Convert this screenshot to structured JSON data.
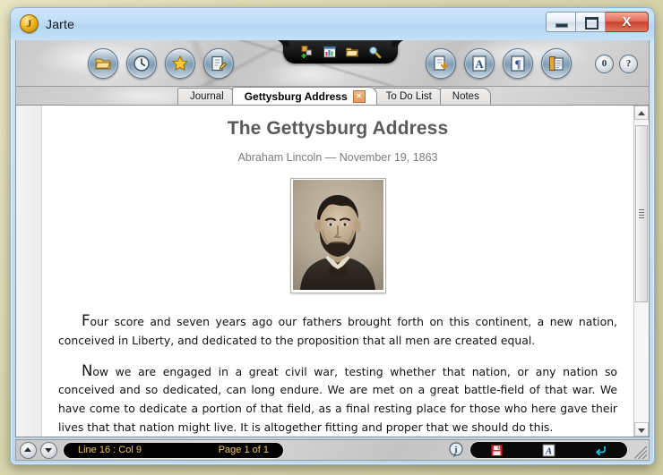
{
  "window": {
    "app_title": "Jarte",
    "logo_letter": "J",
    "controls": {
      "minimize": "–",
      "maximize": "□",
      "close": "X"
    }
  },
  "toolbar": {
    "left_buttons": [
      {
        "name": "open-folder-icon",
        "tip": "Open"
      },
      {
        "name": "clock-icon",
        "tip": "Recent Files"
      },
      {
        "name": "star-icon",
        "tip": "Favorites"
      },
      {
        "name": "edit-note-icon",
        "tip": "Edit"
      }
    ],
    "dock_buttons": [
      {
        "name": "new-document-icon",
        "tip": "New"
      },
      {
        "name": "table-chart-icon",
        "tip": "Insert Table"
      },
      {
        "name": "folder-icon",
        "tip": "Browse"
      },
      {
        "name": "search-icon",
        "tip": "Find"
      }
    ],
    "right_buttons": [
      {
        "name": "save-document-icon",
        "tip": "Save"
      },
      {
        "name": "font-letter-icon",
        "tip": "Font"
      },
      {
        "name": "paragraph-icon",
        "tip": "Paragraph"
      },
      {
        "name": "clipboard-icon",
        "tip": "Clipboard"
      }
    ],
    "extras": [
      {
        "name": "zero-button",
        "label": "0"
      },
      {
        "name": "help-button",
        "label": "?"
      }
    ]
  },
  "tabs": [
    {
      "label": "Journal",
      "active": false,
      "closable": false
    },
    {
      "label": "Gettysburg Address",
      "active": true,
      "closable": true,
      "close_label": "×"
    },
    {
      "label": "To Do List",
      "active": false,
      "closable": false
    },
    {
      "label": "Notes",
      "active": false,
      "closable": false
    }
  ],
  "document": {
    "title": "The Gettysburg Address",
    "byline": "Abraham Lincoln — November 19, 1863",
    "image_alt": "Portrait photograph of Abraham Lincoln",
    "paragraphs": [
      {
        "cap": "F",
        "rest": "our score and seven years ago our fathers brought forth on this continent, a new nation, conceived in Liberty, and dedicated to the proposition that all men are created equal."
      },
      {
        "cap": "N",
        "rest": "ow we are engaged in a great civil war, testing whether that nation, or any nation so conceived and so dedicated, can long endure. We are met on a great battle-field of that war. We have come to dedicate a portion of that field, as a final resting place for those who here gave their lives that that nation might live. It is altogether fitting and proper that we should do this."
      }
    ]
  },
  "statusbar": {
    "nav_up": "▲",
    "nav_down": "▼",
    "cursor_position": "Line 16 : Col 9",
    "page_indicator": "Page 1 of 1",
    "tools": [
      {
        "name": "save-floppy-icon",
        "tip": "Save"
      },
      {
        "name": "font-a-icon",
        "tip": "Font"
      },
      {
        "name": "word-wrap-icon",
        "tip": "Word Wrap"
      }
    ],
    "info": {
      "name": "info-icon",
      "label": "i"
    }
  },
  "colors": {
    "title_gradient_top": "#cfe6fa",
    "close_button": "#c8402a",
    "tab_close": "#e49a5c",
    "status_text": "#f2c75b",
    "doc_title": "#5a5a5a",
    "desktop": "#d8d6ac"
  }
}
